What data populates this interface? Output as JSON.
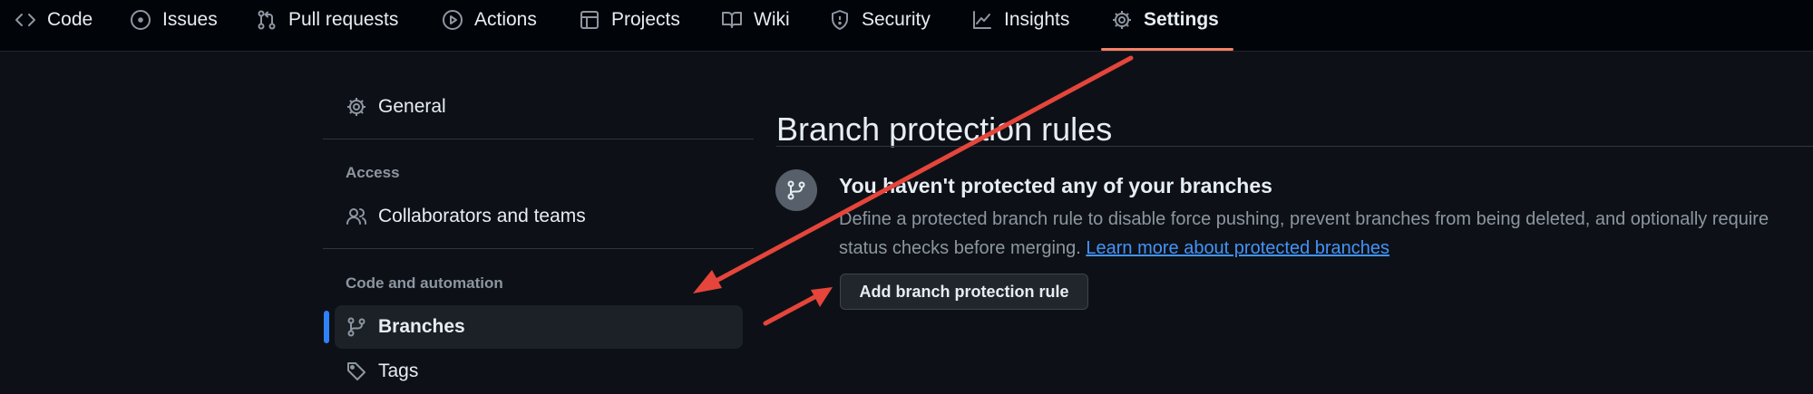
{
  "colors": {
    "background": "#0d1117",
    "nav_background": "#010409",
    "accent_underline": "#f78166",
    "active_indicator": "#2f81f7",
    "link": "#4493f8",
    "annotation_arrow": "#e5453a"
  },
  "repo_nav": {
    "tabs": [
      {
        "label": "Code",
        "icon": "code-icon"
      },
      {
        "label": "Issues",
        "icon": "issue-opened-icon"
      },
      {
        "label": "Pull requests",
        "icon": "git-pull-request-icon"
      },
      {
        "label": "Actions",
        "icon": "play-icon"
      },
      {
        "label": "Projects",
        "icon": "table-icon"
      },
      {
        "label": "Wiki",
        "icon": "book-icon"
      },
      {
        "label": "Security",
        "icon": "shield-icon"
      },
      {
        "label": "Insights",
        "icon": "graph-icon"
      },
      {
        "label": "Settings",
        "icon": "gear-icon",
        "active": true
      }
    ]
  },
  "sidebar": {
    "general": {
      "label": "General",
      "icon": "gear-icon"
    },
    "access_heading": "Access",
    "collaborators": {
      "label": "Collaborators and teams",
      "icon": "people-icon"
    },
    "automation_heading": "Code and automation",
    "branches": {
      "label": "Branches",
      "icon": "git-branch-icon",
      "active": true
    },
    "tags": {
      "label": "Tags",
      "icon": "tag-icon"
    }
  },
  "main": {
    "title": "Branch protection rules",
    "blankslate": {
      "icon": "git-branch-icon",
      "title": "You haven't protected any of your branches",
      "description": "Define a protected branch rule to disable force pushing, prevent branches from being deleted, and optionally require status checks before merging.",
      "link_text": "Learn more about protected branches"
    },
    "add_rule_button": "Add branch protection rule"
  }
}
